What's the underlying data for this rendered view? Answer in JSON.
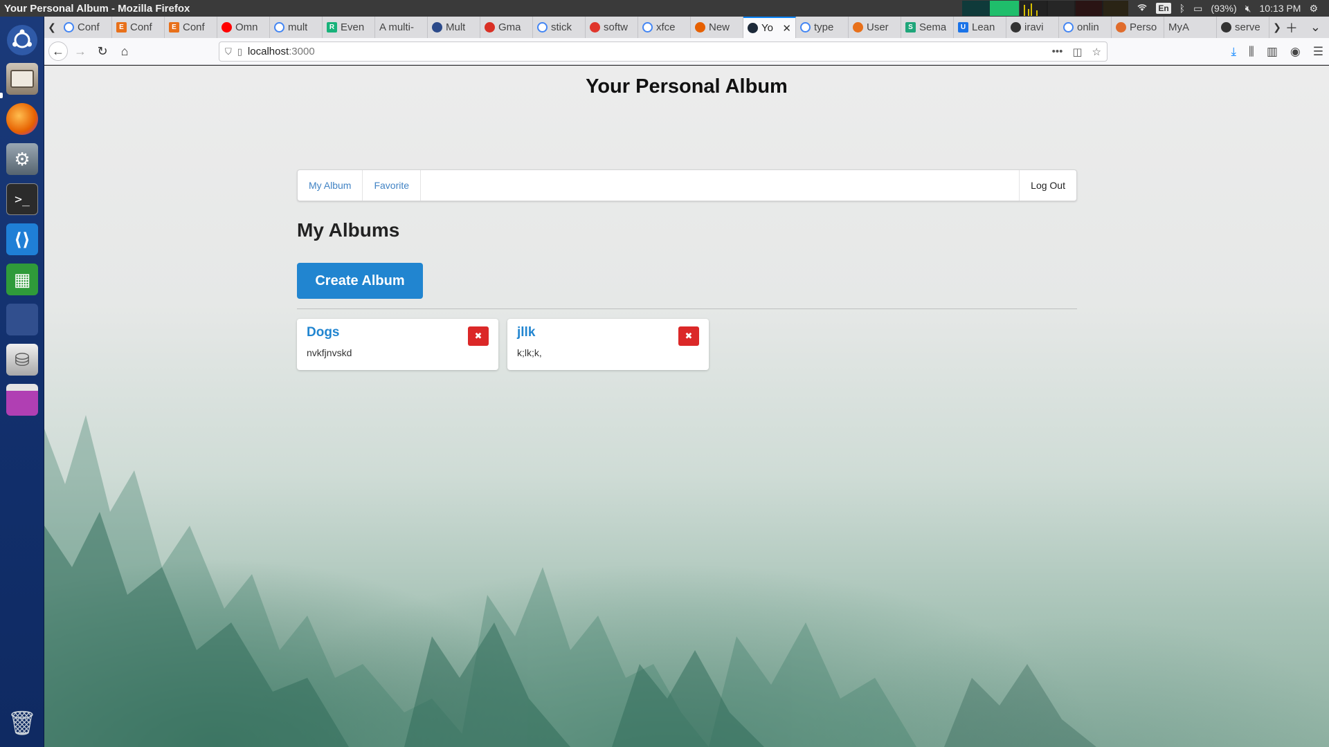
{
  "window": {
    "title": "Your Personal Album - Mozilla Firefox"
  },
  "system": {
    "language": "En",
    "battery": "(93%)",
    "clock": "10:13 PM"
  },
  "launcher": {
    "items": [
      {
        "name": "ubuntu-logo-icon",
        "color": "#2f5aa8"
      },
      {
        "name": "files-icon",
        "color": "#8a7c6b"
      },
      {
        "name": "firefox-icon",
        "color": "#e66000"
      },
      {
        "name": "settings-icon",
        "color": "#6b7c8c"
      },
      {
        "name": "terminal-icon",
        "color": "#2b2b2b"
      },
      {
        "name": "vscode-icon",
        "color": "#1f7fd6"
      },
      {
        "name": "spreadsheet-icon",
        "color": "#2f9b3a"
      },
      {
        "name": "workspace-switcher-icon",
        "color": "#314f8e"
      },
      {
        "name": "disk-icon",
        "color": "#c9c9c9"
      },
      {
        "name": "app-window-icon",
        "color": "#b03fb3"
      },
      {
        "name": "trash-icon",
        "color": "#9aa3ad"
      }
    ]
  },
  "tabs": [
    {
      "label": "Conf",
      "fav": "google",
      "color": "#ffffff"
    },
    {
      "label": "Conf",
      "fav": "E",
      "color": "#e8701a"
    },
    {
      "label": "Conf",
      "fav": "E",
      "color": "#e8701a"
    },
    {
      "label": "Omn",
      "fav": "youtube",
      "color": "#ff0000"
    },
    {
      "label": "mult",
      "fav": "google",
      "color": "#ffffff"
    },
    {
      "label": "Even",
      "fav": "R",
      "color": "#18b27a"
    },
    {
      "label": "A multi-",
      "fav": "",
      "color": ""
    },
    {
      "label": "Mult",
      "fav": "arc",
      "color": "#2b4a8a"
    },
    {
      "label": "Gma",
      "fav": "gmail",
      "color": "#d93025"
    },
    {
      "label": "stick",
      "fav": "google",
      "color": "#ffffff"
    },
    {
      "label": "softw",
      "fav": "ask",
      "color": "#e0352b"
    },
    {
      "label": "xfce",
      "fav": "google",
      "color": "#ffffff"
    },
    {
      "label": "New",
      "fav": "firefox",
      "color": "#e66000"
    },
    {
      "label": "Yo",
      "fav": "react",
      "color": "#1d2a3a",
      "active": true
    },
    {
      "label": "type",
      "fav": "google",
      "color": "#ffffff"
    },
    {
      "label": "User",
      "fav": "lambda",
      "color": "#e8701a"
    },
    {
      "label": "Sema",
      "fav": "S",
      "color": "#1fa67a"
    },
    {
      "label": "Lean",
      "fav": "U",
      "color": "#1a73e8"
    },
    {
      "label": "iravi",
      "fav": "github",
      "color": "#333333"
    },
    {
      "label": "onlin",
      "fav": "google",
      "color": "#ffffff"
    },
    {
      "label": "Perso",
      "fav": "chart",
      "color": "#e06c2c"
    },
    {
      "label": "MyA",
      "fav": "",
      "color": ""
    },
    {
      "label": "serve",
      "fav": "github",
      "color": "#333333"
    }
  ],
  "address": {
    "host": "localhost",
    "port": ":3000"
  },
  "page": {
    "title": "Your Personal Album",
    "menu": {
      "my_album": "My Album",
      "favorite": "Favorite",
      "logout": "Log Out"
    },
    "section_title": "My Albums",
    "create_button": "Create Album",
    "delete_glyph": "✖",
    "albums": [
      {
        "title": "Dogs",
        "description": "nvkfjnvskd"
      },
      {
        "title": "jllk",
        "description": "k;lk;k,"
      }
    ]
  }
}
